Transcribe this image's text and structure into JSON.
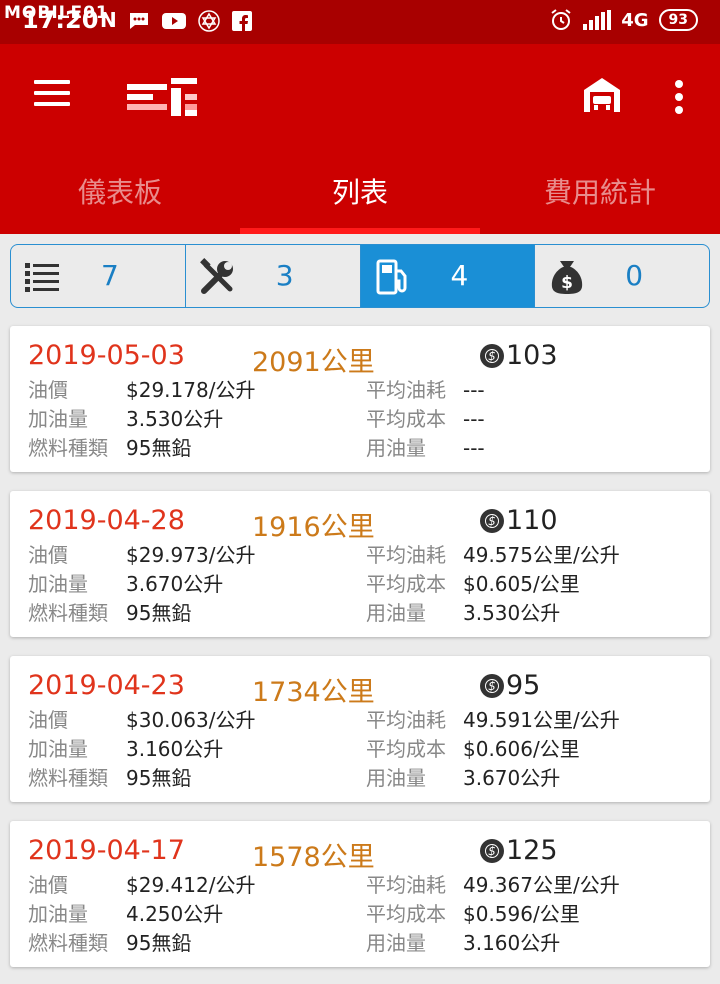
{
  "status_bar": {
    "watermark": "MOBILE01",
    "time": "17:20",
    "network": "4G",
    "battery": "93"
  },
  "app_bar": {
    "icons": [
      "menu-icon",
      "logo",
      "garage-icon",
      "more-vert-icon"
    ]
  },
  "tabs": [
    {
      "label": "儀表板",
      "active": false
    },
    {
      "label": "列表",
      "active": true
    },
    {
      "label": "費用統計",
      "active": false
    }
  ],
  "filter": [
    {
      "icon": "list-icon",
      "count": "7",
      "active": false
    },
    {
      "icon": "wrench-icon",
      "count": "3",
      "active": false
    },
    {
      "icon": "fuel-pump-icon",
      "count": "4",
      "active": true
    },
    {
      "icon": "money-bag-icon",
      "count": "0",
      "active": false
    }
  ],
  "labels": {
    "price": "油價",
    "volume": "加油量",
    "fuel_type": "燃料種類",
    "avg_consumption": "平均油耗",
    "avg_cost": "平均成本",
    "used": "用油量"
  },
  "records": [
    {
      "date": "2019-05-03",
      "odometer": "2091公里",
      "cost": "103",
      "price": "$29.178/公升",
      "volume": "3.530公升",
      "fuel_type": "95無鉛",
      "avg_consumption": "---",
      "avg_cost": "---",
      "used": "---"
    },
    {
      "date": "2019-04-28",
      "odometer": "1916公里",
      "cost": "110",
      "price": "$29.973/公升",
      "volume": "3.670公升",
      "fuel_type": "95無鉛",
      "avg_consumption": "49.575公里/公升",
      "avg_cost": "$0.605/公里",
      "used": "3.530公升"
    },
    {
      "date": "2019-04-23",
      "odometer": "1734公里",
      "cost": "95",
      "price": "$30.063/公升",
      "volume": "3.160公升",
      "fuel_type": "95無鉛",
      "avg_consumption": "49.591公里/公升",
      "avg_cost": "$0.606/公里",
      "used": "3.670公升"
    },
    {
      "date": "2019-04-17",
      "odometer": "1578公里",
      "cost": "125",
      "price": "$29.412/公升",
      "volume": "4.250公升",
      "fuel_type": "95無鉛",
      "avg_consumption": "49.367公里/公升",
      "avg_cost": "$0.596/公里",
      "used": "3.160公升"
    }
  ]
}
